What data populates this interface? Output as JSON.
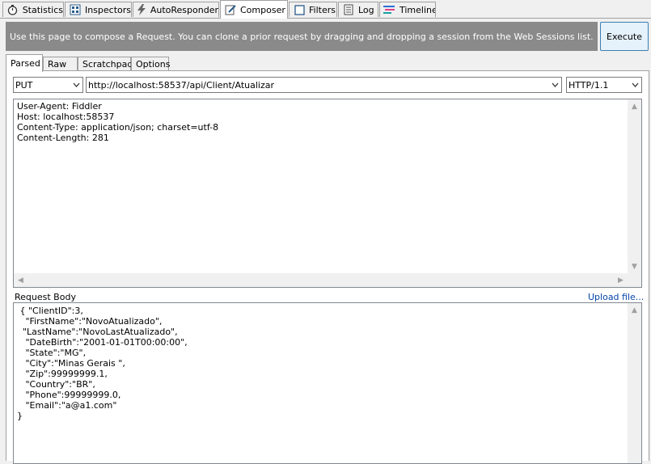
{
  "top_tabs": [
    {
      "label": "Statistics",
      "icon": "stopwatch-icon"
    },
    {
      "label": "Inspectors",
      "icon": "inspect-grid-icon"
    },
    {
      "label": "AutoResponder",
      "icon": "lightning-icon"
    },
    {
      "label": "Composer",
      "icon": "pencil-icon",
      "active": true
    },
    {
      "label": "Filters",
      "icon": "checkbox-icon"
    },
    {
      "label": "Log",
      "icon": "log-document-icon"
    },
    {
      "label": "Timeline",
      "icon": "timeline-bars-icon"
    }
  ],
  "banner": {
    "text": "Use this page to compose a Request. You can clone a prior request by dragging and dropping a session from the Web Sessions list."
  },
  "execute": {
    "label": "Execute"
  },
  "composer_tabs": [
    {
      "label": "Parsed",
      "active": true
    },
    {
      "label": "Raw"
    },
    {
      "label": "Scratchpad"
    },
    {
      "label": "Options"
    }
  ],
  "request": {
    "method": "PUT",
    "url": "http://localhost:58537/api/Client/Atualizar",
    "version": "HTTP/1.1"
  },
  "headers": [
    "User-Agent: Fiddler",
    "Host: localhost:58537",
    "Content-Type: application/json; charset=utf-8",
    "Content-Length: 281"
  ],
  "body": {
    "label": "Request Body",
    "upload_label": "Upload file...",
    "lines": [
      " { \"ClientID\":3,",
      "   \"FirstName\":\"NovoAtualizado\",",
      "  \"LastName\":\"NovoLastAtualizado\",",
      "   \"DateBirth\":\"2001-01-01T00:00:00\",",
      "   \"State\":\"MG\",",
      "   \"City\":\"Minas Gerais \",",
      "   \"Zip\":99999999.1,",
      "   \"Country\":\"BR\",",
      "   \"Phone\":99999999.0,",
      "   \"Email\":\"a@a1.com\"",
      "}"
    ]
  },
  "colors": {
    "banner_bg": "#8a8a8a",
    "link": "#0645ad",
    "execute_border": "#3c7fb1"
  }
}
